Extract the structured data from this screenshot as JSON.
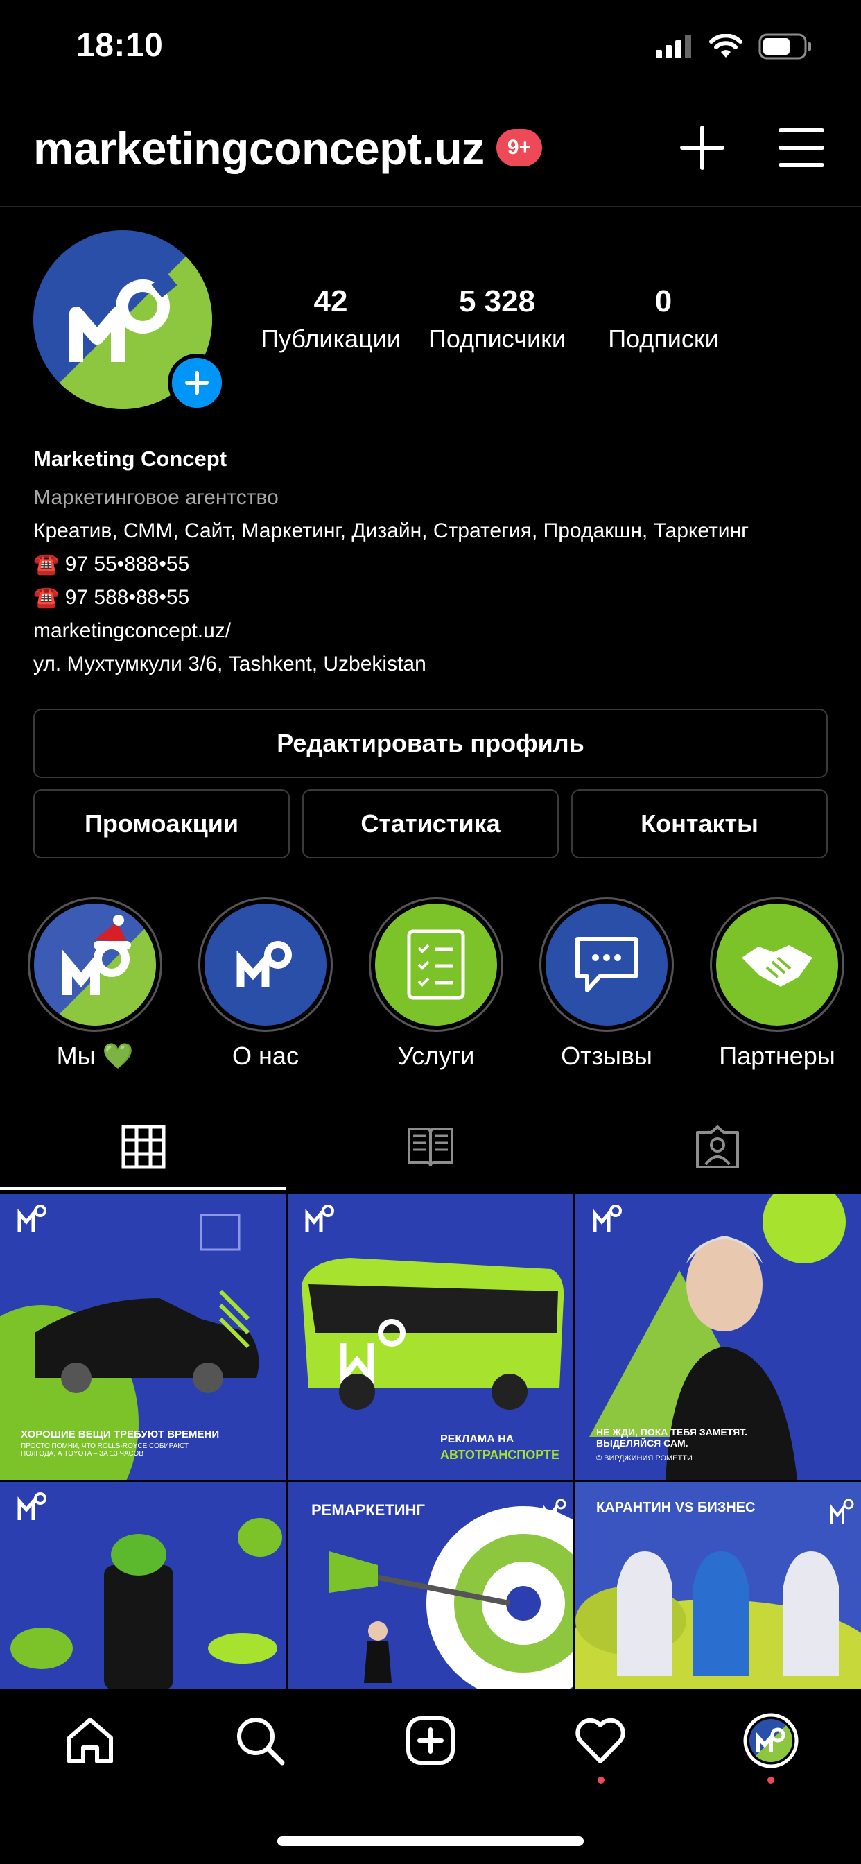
{
  "status_bar": {
    "time": "18:10"
  },
  "header": {
    "username": "marketingconcept.uz",
    "notification_badge": "9+"
  },
  "profile": {
    "stats": [
      {
        "value": "42",
        "label": "Публикации"
      },
      {
        "value": "5 328",
        "label": "Подписчики"
      },
      {
        "value": "0",
        "label": "Подписки"
      }
    ],
    "bio": {
      "name": "Marketing Concept",
      "category": "Маркетинговое агентство",
      "description": "Креатив, СММ, Сайт, Маркетинг, Дизайн, Стратегия, Продакшн, Таркетинг",
      "phone1": "☎️ 97 55•888•55",
      "phone2": "☎️ 97 588•88•55",
      "link": "marketingconcept.uz/",
      "address": "ул. Мухтумкули 3/6, Tashkent, Uzbekistan"
    }
  },
  "buttons": {
    "edit_profile": "Редактировать профиль",
    "promo": "Промоакции",
    "stats": "Статистика",
    "contacts": "Контакты"
  },
  "highlights": [
    {
      "label": "Мы 💚"
    },
    {
      "label": "О нас"
    },
    {
      "label": "Услуги"
    },
    {
      "label": "Отзывы"
    },
    {
      "label": "Партнеры"
    }
  ],
  "tabs": [
    {
      "icon": "grid-icon",
      "active": true
    },
    {
      "icon": "guide-icon",
      "active": false
    },
    {
      "icon": "tagged-icon",
      "active": false
    }
  ],
  "posts": [
    {
      "caption": "ХОРОШИЕ ВЕЩИ ТРЕБУЮТ ВРЕМЕНИ",
      "sub": "ПРОСТО ПОМНИ, ЧТО ROLLS-ROYCE СОБИРАЮТ ПОЛГОДА, А TOYOTA – ЗА 13 ЧАСОВ"
    },
    {
      "caption": "РЕКЛАМА НА",
      "sub": "АВТОТРАНСПОРТЕ"
    },
    {
      "caption": "НЕ ЖДИ, ПОКА ТЕБЯ ЗАМЕТЯТ. ВЫДЕЛЯЙСЯ САМ.",
      "sub": "© ВИРДЖИНИЯ РОМЕТТИ"
    },
    {
      "caption": "",
      "sub": ""
    },
    {
      "caption": "РЕМАРКЕТИНГ",
      "sub": ""
    },
    {
      "caption": "КАРАНТИН VS БИЗНЕС",
      "sub": ""
    }
  ],
  "colors": {
    "accent_green": "#8dc63f",
    "brand_blue": "#2a4fa8",
    "notification_red": "#ed4956",
    "link_blue": "#0095f6"
  }
}
